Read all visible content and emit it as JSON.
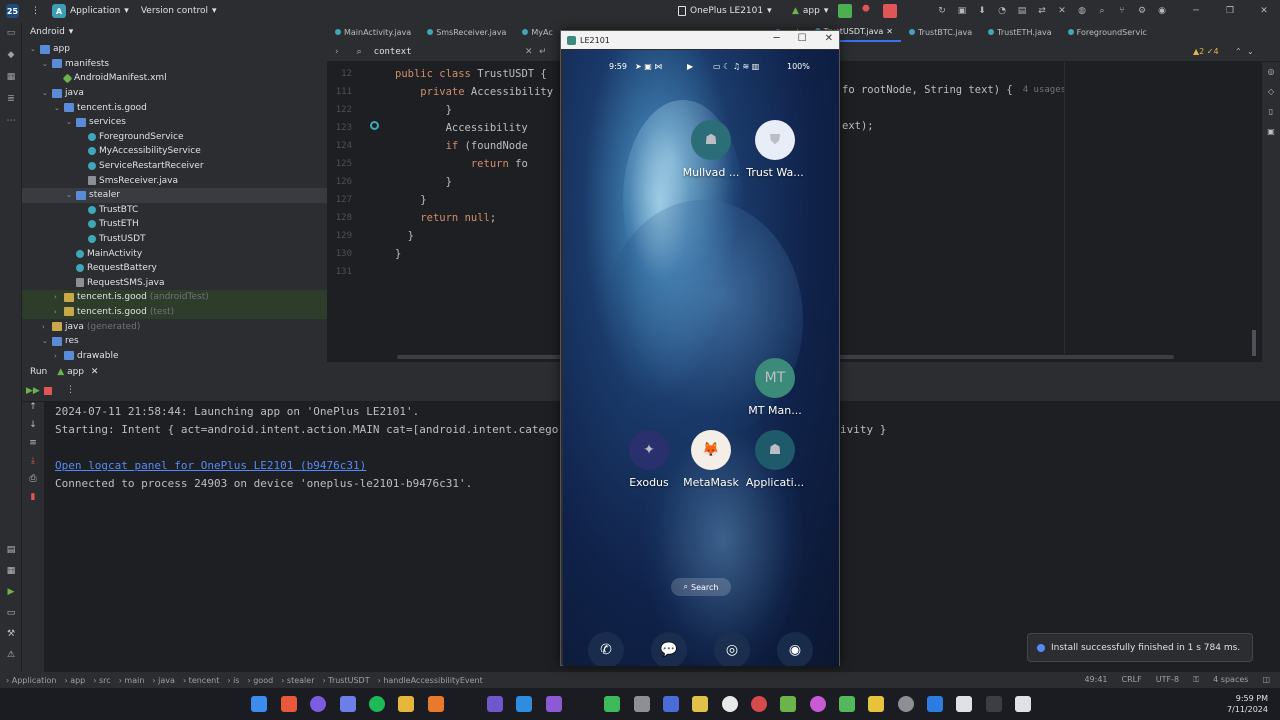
{
  "titlebar": {
    "project": "Application",
    "vcs": "Version control",
    "device": "OnePlus LE2101",
    "config": "app"
  },
  "project_panel": {
    "view": "Android",
    "tree": [
      {
        "label": "app",
        "type": "folder",
        "indent": 0,
        "open": true
      },
      {
        "label": "manifests",
        "type": "folder",
        "indent": 1,
        "open": true
      },
      {
        "label": "AndroidManifest.xml",
        "type": "xml",
        "indent": 2
      },
      {
        "label": "java",
        "type": "folder",
        "indent": 1,
        "open": true
      },
      {
        "label": "tencent.is.good",
        "type": "folder",
        "indent": 2,
        "open": true
      },
      {
        "label": "services",
        "type": "folder",
        "indent": 3,
        "open": true
      },
      {
        "label": "ForegroundService",
        "type": "java",
        "indent": 4
      },
      {
        "label": "MyAccessibilityService",
        "type": "java",
        "indent": 4
      },
      {
        "label": "ServiceRestartReceiver",
        "type": "java",
        "indent": 4
      },
      {
        "label": "SmsReceiver.java",
        "type": "file",
        "indent": 4
      },
      {
        "label": "stealer",
        "type": "folder",
        "indent": 3,
        "open": true,
        "selected": true
      },
      {
        "label": "TrustBTC",
        "type": "java",
        "indent": 4
      },
      {
        "label": "TrustETH",
        "type": "java",
        "indent": 4
      },
      {
        "label": "TrustUSDT",
        "type": "java",
        "indent": 4
      },
      {
        "label": "MainActivity",
        "type": "java",
        "indent": 3
      },
      {
        "label": "RequestBattery",
        "type": "java",
        "indent": 3
      },
      {
        "label": "RequestSMS.java",
        "type": "file",
        "indent": 3
      },
      {
        "label": "tencent.is.good",
        "suffix": "(androidTest)",
        "type": "yfolder",
        "indent": 2,
        "green": true
      },
      {
        "label": "tencent.is.good",
        "suffix": "(test)",
        "type": "yfolder",
        "indent": 2,
        "green": true
      },
      {
        "label": "java",
        "suffix": "(generated)",
        "type": "yfolder",
        "indent": 1
      },
      {
        "label": "res",
        "type": "folder",
        "indent": 1,
        "open": true
      },
      {
        "label": "drawable",
        "type": "folder",
        "indent": 2
      }
    ]
  },
  "tabs": [
    {
      "label": "MainActivity.java",
      "active": false
    },
    {
      "label": "SmsReceiver.java",
      "active": false
    },
    {
      "label": "MyAc",
      "active": false
    },
    {
      "label": "xml",
      "active": false
    },
    {
      "label": "TrustUSDT.java",
      "active": true
    },
    {
      "label": "TrustBTC.java",
      "active": false
    },
    {
      "label": "TrustETH.java",
      "active": false
    },
    {
      "label": "ForegroundServic",
      "active": false
    }
  ],
  "search": {
    "query": "context"
  },
  "editor": {
    "lines": [
      {
        "n": "12",
        "code": "public class TrustUSDT {",
        "indent": 0
      },
      {
        "n": "111",
        "code": "    private Accessibility",
        "indent": 0
      },
      {
        "n": "122",
        "code": "        }",
        "indent": 0
      },
      {
        "n": "123",
        "code": "        Accessibility",
        "indent": 0
      },
      {
        "n": "124",
        "code": "        if (foundNode",
        "indent": 0
      },
      {
        "n": "125",
        "code": "            return fo",
        "indent": 0
      },
      {
        "n": "126",
        "code": "        }",
        "indent": 0
      },
      {
        "n": "127",
        "code": "    }",
        "indent": 0
      },
      {
        "n": "128",
        "code": "    return null;",
        "indent": 0
      },
      {
        "n": "129",
        "code": "  }",
        "indent": 0
      },
      {
        "n": "130",
        "code": "}",
        "indent": 0
      },
      {
        "n": "131",
        "code": "",
        "indent": 0
      }
    ],
    "right_111": "fo rootNode, String text) {",
    "right_111_hint": "4 usages",
    "right_123": "ext);",
    "warnings": "▲2  ✓4"
  },
  "run": {
    "tab": "Run",
    "config": "app",
    "console": [
      "2024-07-11 21:58:44: Launching app on 'OnePlus LE2101'.",
      "Starting: Intent { act=android.intent.action.MAIN cat=[android.intent.catego",
      "Open logcat panel for OnePlus LE2101 (b9476c31)",
      "Connected to process 24903 on device 'oneplus-le2101-b9476c31'."
    ],
    "console_right": "ivity }"
  },
  "statusbar": {
    "crumbs": [
      "Application",
      "app",
      "src",
      "main",
      "java",
      "tencent",
      "is",
      "good",
      "stealer",
      "TrustUSDT",
      "handleAccessibilityEvent"
    ],
    "position": "49:41",
    "line_sep": "CRLF",
    "encoding": "UTF-8",
    "indent": "4 spaces"
  },
  "toast": {
    "message": "Install successfully finished in 1 s 784 ms."
  },
  "emulator": {
    "title": "LE2101",
    "time": "9:59",
    "battery": "100%",
    "apps": [
      {
        "label": "Mullvad ...",
        "glyph": "☗",
        "bg": "#2c6e78"
      },
      {
        "label": "Trust Wa...",
        "glyph": "⛊",
        "bg": "#e8eef8"
      },
      {
        "label": "MT Man...",
        "glyph": "MT",
        "bg": "#3c8a7a"
      },
      {
        "label": "Exodus",
        "glyph": "✦",
        "bg": "#2a2f6e"
      },
      {
        "label": "MetaMask",
        "glyph": "🦊",
        "bg": "#f4eee6"
      },
      {
        "label": "Applicati...",
        "glyph": "☗",
        "bg": "#1f5a6a"
      }
    ],
    "search_label": "Search",
    "dock": [
      "✆",
      "💬",
      "◎",
      "◉"
    ]
  },
  "taskbar": {
    "time": "9:59 PM",
    "date": "7/11/2024"
  },
  "colors": {
    "accent": "#3574f0",
    "keyword": "#cf8e6d",
    "link": "#548af7"
  }
}
